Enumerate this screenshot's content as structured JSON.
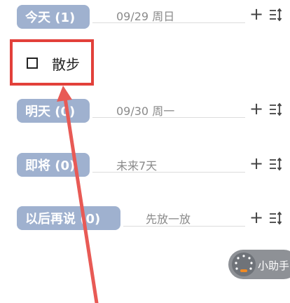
{
  "groups": [
    {
      "label": "今天 (1)",
      "subtitle": "09/29 周日"
    },
    {
      "label": "明天 (0)",
      "subtitle": "09/30 周一"
    },
    {
      "label": "即将 (0)",
      "subtitle": "未来7天"
    },
    {
      "label": "以后再说 (0)",
      "subtitle": "先放一放"
    }
  ],
  "task": {
    "label": "散步",
    "checked": false
  },
  "assistant": {
    "label": "小助手"
  },
  "icons": {
    "add": "plus-icon",
    "sort": "sort-icon"
  },
  "colors": {
    "pill": "#9fb1cf",
    "highlight": "#e2403a",
    "annotation_arrow": "#e85a55"
  }
}
